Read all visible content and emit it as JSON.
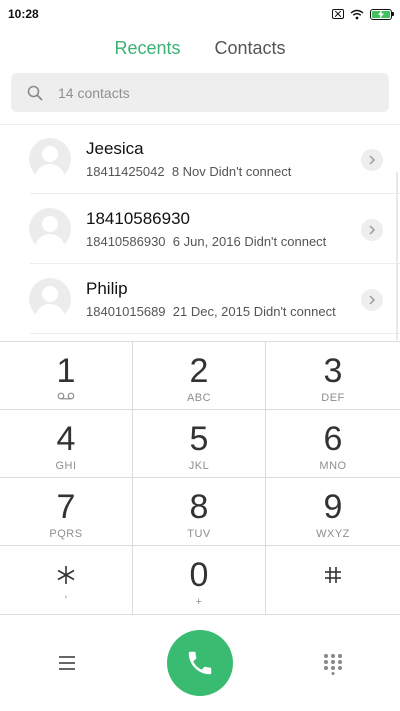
{
  "status_bar": {
    "time": "10:28"
  },
  "tabs": {
    "recents": "Recents",
    "contacts": "Contacts"
  },
  "colors": {
    "accent": "#3bb273",
    "call_button": "#39bb72",
    "battery_fill": "#42c15f"
  },
  "search": {
    "placeholder": "14 contacts",
    "icon": "search-icon"
  },
  "recents": [
    {
      "name": "Jeesica",
      "number": "18411425042",
      "detail": "8 Nov Didn't connect"
    },
    {
      "name": "18410586930",
      "number": "18410586930",
      "detail": "6 Jun, 2016 Didn't connect"
    },
    {
      "name": "Philip",
      "number": "18401015689",
      "detail": "21 Dec, 2015 Didn't connect"
    }
  ],
  "dialpad": [
    {
      "digit": "1",
      "letters": ""
    },
    {
      "digit": "2",
      "letters": "ABC"
    },
    {
      "digit": "3",
      "letters": "DEF"
    },
    {
      "digit": "4",
      "letters": "GHI"
    },
    {
      "digit": "5",
      "letters": "JKL"
    },
    {
      "digit": "6",
      "letters": "MNO"
    },
    {
      "digit": "7",
      "letters": "PQRS"
    },
    {
      "digit": "8",
      "letters": "TUV"
    },
    {
      "digit": "9",
      "letters": "WXYZ"
    },
    {
      "digit": "",
      "letters": ","
    },
    {
      "digit": "0",
      "letters": "+"
    },
    {
      "digit": "",
      "letters": ""
    }
  ],
  "bottom_bar": {
    "menu_icon": "menu-icon",
    "call_icon": "phone-icon",
    "dialpad_icon": "dialpad-grid-icon"
  }
}
